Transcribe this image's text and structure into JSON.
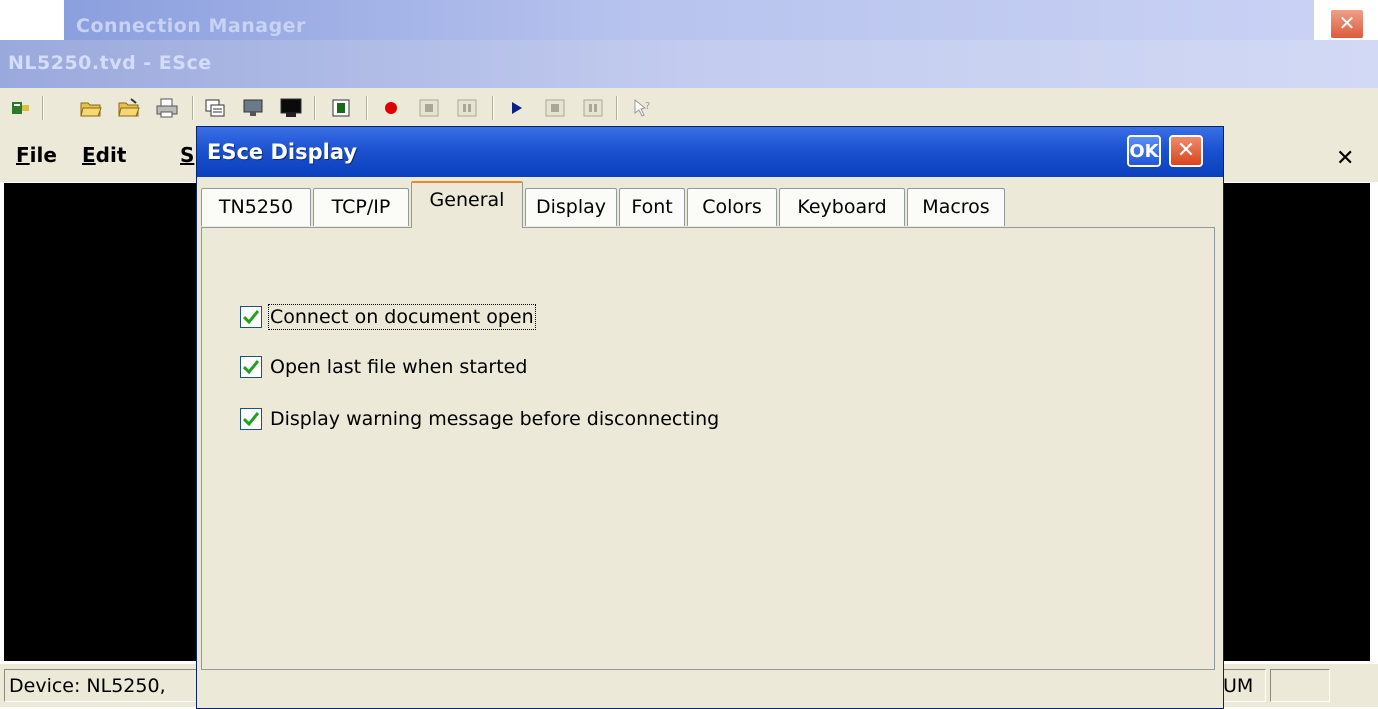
{
  "background_window": {
    "title": "Connection Manager",
    "close_glyph": "✕"
  },
  "main_window": {
    "title": "NL5250.tvd - ESce",
    "close_glyph": "✕",
    "menu": [
      {
        "label": "File"
      },
      {
        "label": "Edit"
      },
      {
        "label": "S"
      }
    ],
    "toolbar_icons": [
      "connect-icon",
      "open-folder-icon",
      "open-folder-2-icon",
      "print-icon",
      "copy-screen-icon",
      "disconnect-icon",
      "display-icon",
      "chip-icon",
      "record-icon",
      "stop-icon",
      "pause-icon",
      "play-icon",
      "stop-2-icon",
      "pause-2-icon",
      "help-icon"
    ],
    "status": {
      "device_text": "Device: NL5250,",
      "num_text": "UM"
    }
  },
  "dialog": {
    "title": "ESce Display",
    "ok_label": "OK",
    "close_glyph": "✕",
    "tabs": [
      {
        "label": "TN5250",
        "active": false
      },
      {
        "label": "TCP/IP",
        "active": false
      },
      {
        "label": "General",
        "active": true
      },
      {
        "label": "Display",
        "active": false
      },
      {
        "label": "Font",
        "active": false
      },
      {
        "label": "Colors",
        "active": false
      },
      {
        "label": "Keyboard",
        "active": false
      },
      {
        "label": "Macros",
        "active": false
      }
    ],
    "options": [
      {
        "label": "Connect on document open",
        "checked": true
      },
      {
        "label": "Open last file when started",
        "checked": true
      },
      {
        "label": "Display warning message before disconnecting",
        "checked": true
      }
    ]
  },
  "colors": {
    "dialog_title_blue": "#1c52d0",
    "window_face": "#ece9d8",
    "check_green": "#21a121",
    "active_tab_accent": "#e68b2c"
  }
}
